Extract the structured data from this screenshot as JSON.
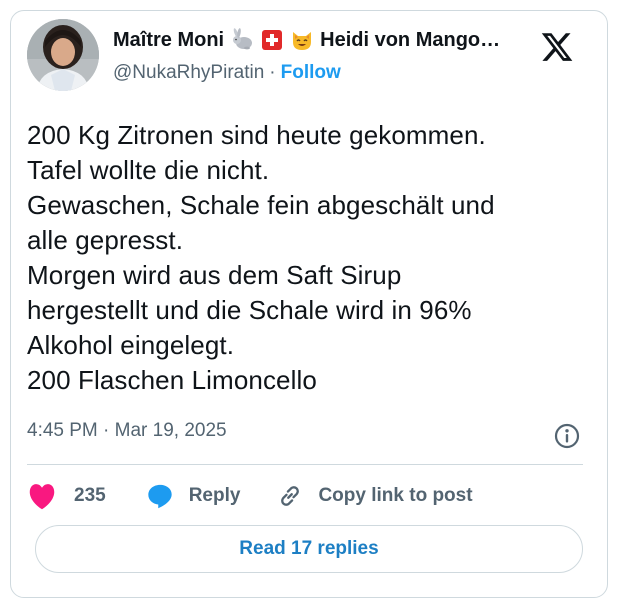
{
  "author": {
    "display_name": "Maître Moni",
    "name_emojis": [
      "rabbit-icon",
      "swiss-flag-icon",
      "smiling-cat-icon"
    ],
    "display_name_2": "Heidi von Mango…",
    "handle": "@NukaRhyPiratin",
    "separator": "·",
    "follow_label": "Follow"
  },
  "tweet": {
    "lines": [
      "200 Kg Zitronen sind heute gekommen.",
      "Tafel wollte die nicht.",
      "Gewaschen, Schale fein abgeschält und",
      "alle gepresst.",
      "Morgen wird aus dem Saft Sirup",
      "hergestellt und die Schale wird in 96%",
      "Alkohol eingelegt.",
      "200 Flaschen Limoncello"
    ],
    "timestamp": "4:45 PM · Mar 19, 2025"
  },
  "actions": {
    "like_count": "235",
    "reply_label": "Reply",
    "copy_link_label": "Copy link to post"
  },
  "read_replies_label": "Read 17 replies",
  "colors": {
    "accent_blue": "#1d9bf0",
    "heart_pink": "#f91880",
    "text_primary": "#0f1419",
    "text_secondary": "#536471",
    "border": "#cfd9de"
  },
  "icons": [
    "x-logo-icon",
    "info-icon",
    "heart-icon",
    "reply-bubble-icon",
    "link-icon"
  ]
}
